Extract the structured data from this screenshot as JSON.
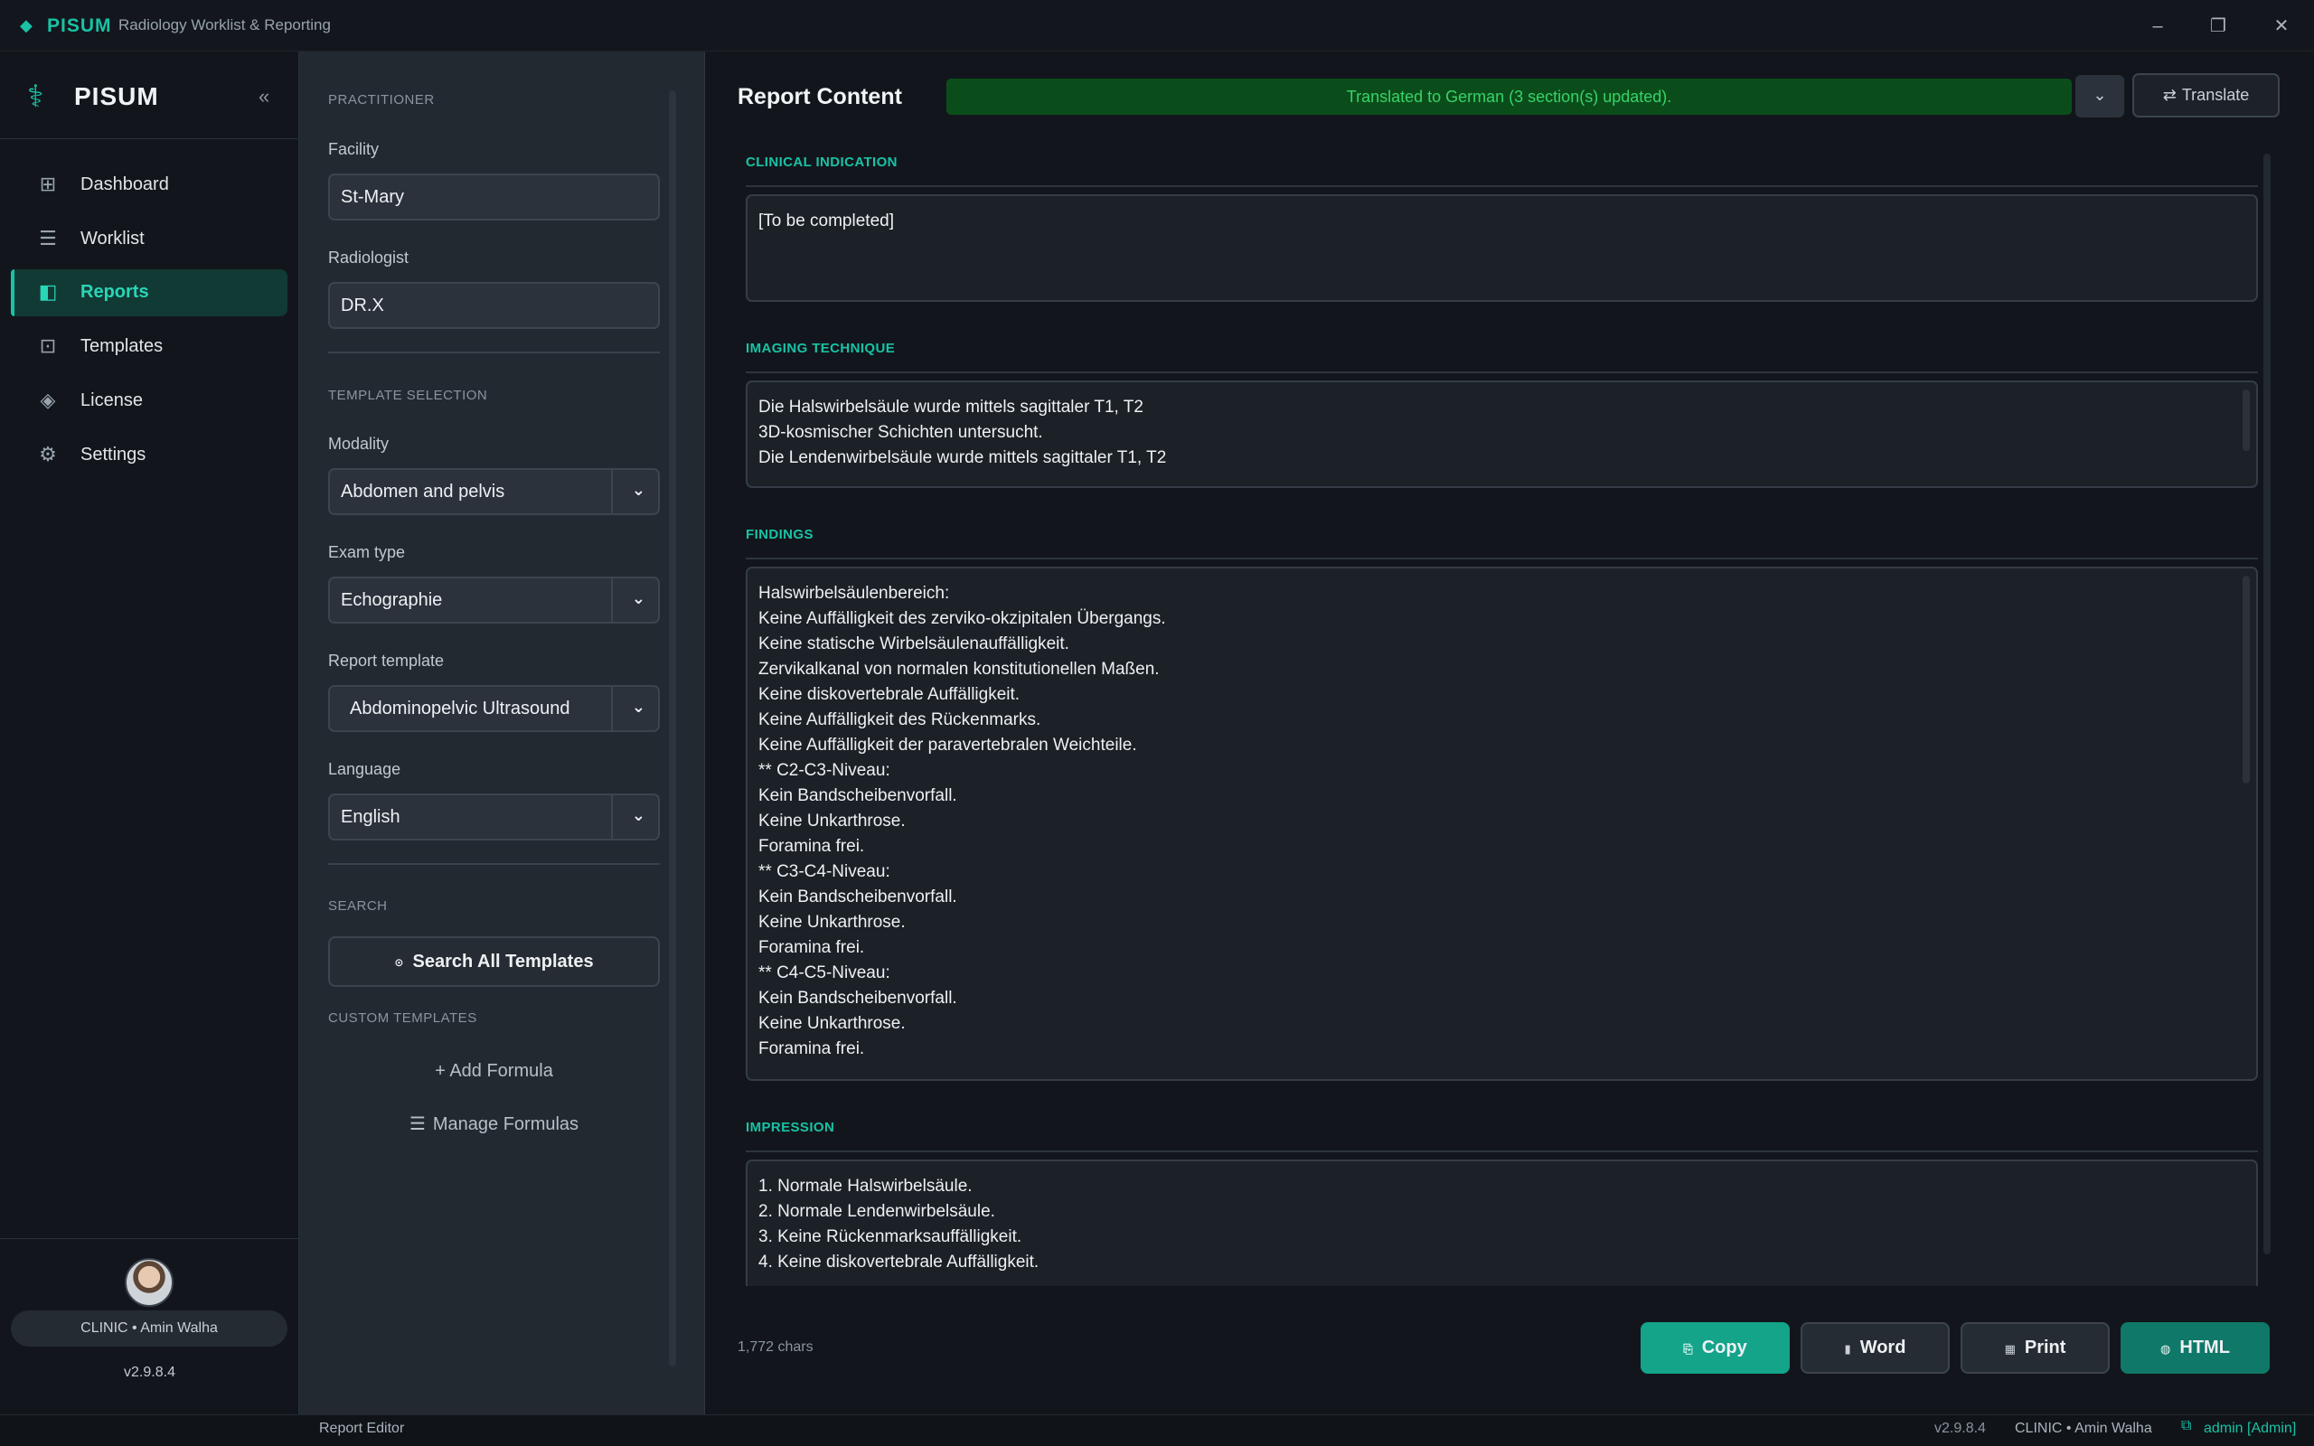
{
  "titlebar": {
    "logo_icon": "◆",
    "app_name": "PISUM",
    "subtitle": "Radiology Worklist & Reporting",
    "minimize": "–",
    "restore": "❐",
    "close": "✕"
  },
  "sidebar": {
    "brand_icon": "⚕",
    "brand_name": "PISUM",
    "collapse_icon": "«",
    "items": [
      {
        "label": "Dashboard",
        "icon": "⊞",
        "icon_name": "dashboard-icon"
      },
      {
        "label": "Worklist",
        "icon": "☰",
        "icon_name": "list-icon"
      },
      {
        "label": "Reports",
        "icon": "◧",
        "icon_name": "report-icon",
        "active": true
      },
      {
        "label": "Templates",
        "icon": "⊡",
        "icon_name": "template-icon"
      },
      {
        "label": "License",
        "icon": "◈",
        "icon_name": "license-icon"
      },
      {
        "label": "Settings",
        "icon": "⚙",
        "icon_name": "gear-icon"
      }
    ],
    "user_badge": "CLINIC • Amin Walha",
    "version": "v2.9.8.4"
  },
  "form": {
    "practitioner_section": "PRACTITIONER",
    "facility_label": "Facility",
    "facility_value": "St-Mary",
    "radiologist_label": "Radiologist",
    "radiologist_value": "DR.X",
    "template_section": "TEMPLATE SELECTION",
    "modality_label": "Modality",
    "modality_value": "Abdomen and pelvis",
    "exam_label": "Exam type",
    "exam_value": "Echographie",
    "template_label": "Report template",
    "template_value": "Abdominopelvic Ultrasound",
    "language_label": "Language",
    "language_value": "English",
    "caret": "⌄",
    "search_section": "SEARCH",
    "search_button_icon": "⊙",
    "search_button": "Search All Templates",
    "custom_section": "CUSTOM TEMPLATES",
    "add_formula": "+ Add Formula",
    "manage_icon": "☰",
    "manage_formulas": "Manage Formulas"
  },
  "report": {
    "title": "Report Content",
    "toast": "Translated to German (3 section(s) updated).",
    "toast_caret": "⌄",
    "translate_icon": "⇄",
    "translate_label": "Translate",
    "sections": {
      "clinical": {
        "label": "CLINICAL INDICATION",
        "lines": [
          "[To be completed]"
        ]
      },
      "technique": {
        "label": "IMAGING TECHNIQUE",
        "lines": [
          "Die Halswirbelsäule wurde mittels sagittaler T1, T2",
          "3D-kosmischer Schichten untersucht.",
          "Die Lendenwirbelsäule wurde mittels sagittaler T1, T2"
        ]
      },
      "findings": {
        "label": "FINDINGS",
        "lines": [
          "Halswirbelsäulenbereich:",
          "Keine Auffälligkeit des zerviko-okzipitalen Übergangs.",
          "Keine statische Wirbelsäulenauffälligkeit.",
          "Zervikalkanal von normalen konstitutionellen Maßen.",
          "Keine diskovertebrale Auffälligkeit.",
          "Keine Auffälligkeit des Rückenmarks.",
          "Keine Auffälligkeit der paravertebralen Weichteile.",
          "** C2-C3-Niveau:",
          "Kein Bandscheibenvorfall.",
          "Keine Unkarthrose.",
          "Foramina frei.",
          "** C3-C4-Niveau:",
          "Kein Bandscheibenvorfall.",
          "Keine Unkarthrose.",
          "Foramina frei.",
          "** C4-C5-Niveau:",
          "Kein Bandscheibenvorfall.",
          "Keine Unkarthrose.",
          "Foramina frei."
        ]
      },
      "impression": {
        "label": "IMPRESSION",
        "lines": [
          "1. Normale Halswirbelsäule.",
          "2. Normale Lendenwirbelsäule.",
          "3. Keine Rückenmarksauffälligkeit.",
          "4. Keine diskovertebrale Auffälligkeit."
        ]
      }
    },
    "char_count": "1,772 chars",
    "buttons": {
      "copy": "Copy",
      "copy_icon": "⎘",
      "word": "Word",
      "word_icon": "▮",
      "print": "Print",
      "print_icon": "▦",
      "html": "HTML",
      "html_icon": "◍"
    }
  },
  "statusbar": {
    "left": "Report Editor",
    "version": "v2.9.8.4",
    "clinic": "CLINIC • Amin Walha",
    "admin_icon": "⧉",
    "admin": "admin [Admin]"
  }
}
